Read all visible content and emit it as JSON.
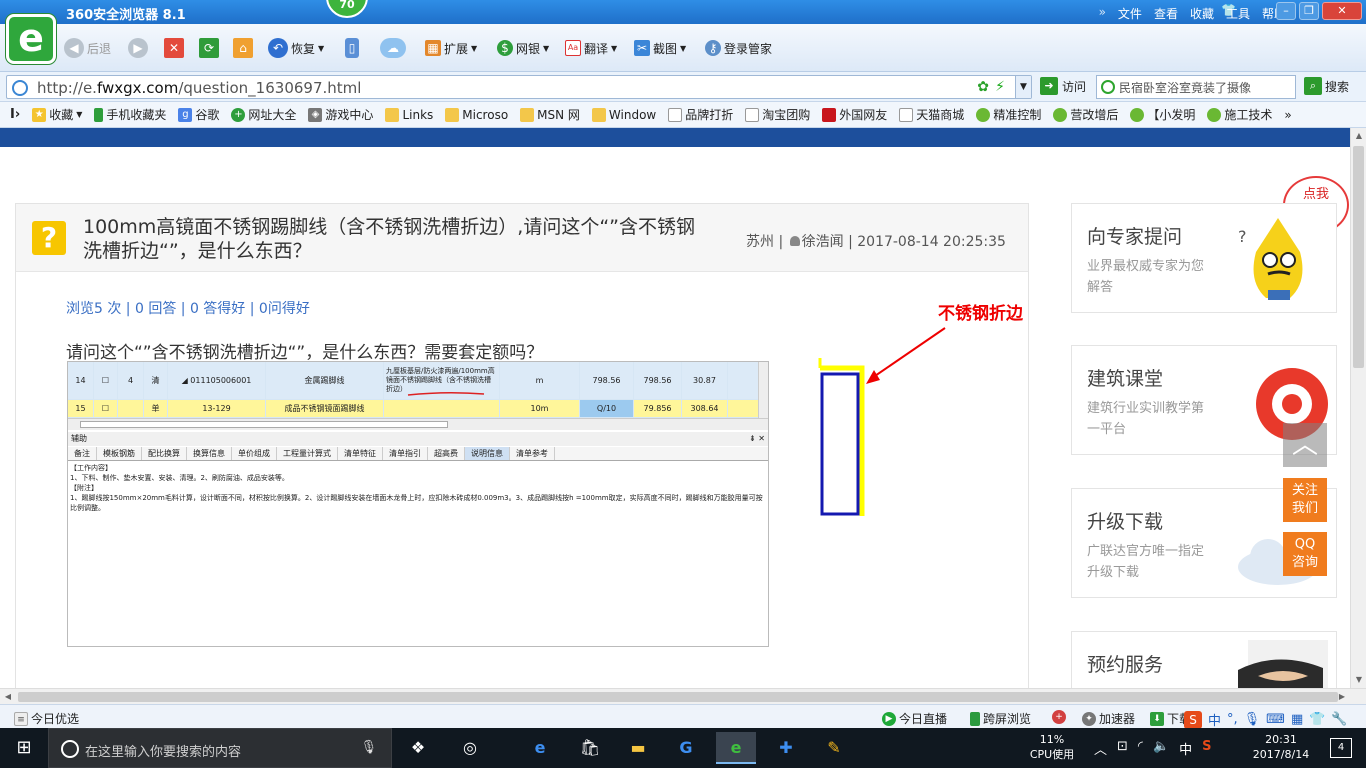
{
  "browser": {
    "title": "360安全浏览器 8.1",
    "badge": "70",
    "menu": [
      "文件",
      "查看",
      "收藏",
      "工具",
      "帮助"
    ],
    "menu_chev": "»",
    "logo_letter": "e",
    "toolbar": {
      "back": "后退",
      "restore": "恢复",
      "extend": "扩展",
      "netbank": "网银",
      "translate": "翻译",
      "screenshot": "截图",
      "login": "登录管家"
    },
    "url_prefix": "http://e.",
    "url_domain": "fwxgx.com",
    "url_path": "/question_1630697.html",
    "visit": "访问",
    "search_value": "民宿卧室浴室竟装了摄像",
    "search_btn": "搜索",
    "favorites": [
      {
        "label": "收藏",
        "kind": "star"
      },
      {
        "label": "手机收藏夹",
        "kind": "phone"
      },
      {
        "label": "谷歌",
        "kind": "google"
      },
      {
        "label": "网址大全",
        "kind": "nav"
      },
      {
        "label": "游戏中心",
        "kind": "game"
      },
      {
        "label": "Links",
        "kind": "folder"
      },
      {
        "label": "Microso",
        "kind": "folder"
      },
      {
        "label": "MSN 网",
        "kind": "folder"
      },
      {
        "label": "Window",
        "kind": "folder"
      },
      {
        "label": "品牌打折",
        "kind": "page"
      },
      {
        "label": "淘宝团购",
        "kind": "page"
      },
      {
        "label": "外国网友",
        "kind": "red"
      },
      {
        "label": "天猫商城",
        "kind": "page"
      },
      {
        "label": "精准控制",
        "kind": "chat"
      },
      {
        "label": "营改增后",
        "kind": "chat"
      },
      {
        "label": "【小发明",
        "kind": "chat"
      },
      {
        "label": "施工技术",
        "kind": "chat"
      }
    ],
    "fav_more": "»"
  },
  "question": {
    "title": "100mm高镜面不锈钢踢脚线（含不锈钢洗槽折边）,请问这个“”含不锈钢洗槽折边“”，是什么东西？",
    "location": "苏州",
    "author": "徐浩闻",
    "datetime": "2017-08-14 20:25:35",
    "stats": "浏览5 次 | 0 回答 | 0 答得好 | 0问得好",
    "body": "请问这个“”含不锈钢洗槽折边“”，是什么东西？需要套定额吗？",
    "annotation_label": "不锈钢折边"
  },
  "software": {
    "row1": [
      "14",
      "☐",
      "4",
      "清",
      "◢ 011105006001",
      "金属踢脚线",
      "九厘板基层/防火漆两遍/100mm高镜面不锈钢踢脚线（含不锈钢洗槽折边）",
      "m",
      "798.56",
      "798.56",
      "30.87"
    ],
    "row2": [
      "15",
      "☐",
      "",
      "单",
      "13-129",
      "成品不锈钢镜面踢脚线",
      "",
      "10m",
      "Q/10",
      "79.856",
      "308.64"
    ],
    "aux_title": "辅助",
    "aux_controls": "⇟ ✕",
    "tabs": [
      "备注",
      "模板钢筋",
      "配比换算",
      "换算信息",
      "单价组成",
      "工程量计算式",
      "清单特征",
      "清单指引",
      "超高费",
      "说明信息",
      "清单参考"
    ],
    "active_tab": "说明信息",
    "content": [
      "【工作内容】",
      "1、下料、制作、垫木安置、安装、清理。2、刷防腐油、成品安装等。",
      "【附注】",
      "1、踢脚线按150mm×20mm毛料计算，设计断面不同，材积按比例换算。2、设计踢脚线安装在墙面木龙骨上时，应扣除木砖成材0.009m3。3、成品踢脚线按h =100mm取定，实际高度不同时，踢脚线和万能胶用量可按比例调整。"
    ]
  },
  "sidebar": {
    "bubble": "点我\n提问哦",
    "cards": [
      {
        "title": "向专家提问",
        "desc": "业界最权威专家为您解答"
      },
      {
        "title": "建筑课堂",
        "desc": "建筑行业实训教学第一平台"
      },
      {
        "title": "升级下载",
        "desc": "广联达官方唯一指定升级下载"
      },
      {
        "title": "预约服务",
        "desc": ""
      }
    ],
    "totop": "︿",
    "follow": "关注\n我们",
    "qq": "QQ\n咨询"
  },
  "statusbar": {
    "left": "今日优选",
    "live": "今日直播",
    "cross": "跨屏浏览",
    "accel": "加速器",
    "download": "下载",
    "ime": "中"
  },
  "taskbar": {
    "search_placeholder": "在这里输入你要搜索的内容",
    "cpu_pct": "11%",
    "cpu_label": "CPU使用",
    "tray_lang": "中",
    "time": "20:31",
    "date": "2017/8/14",
    "notif_count": "4"
  }
}
